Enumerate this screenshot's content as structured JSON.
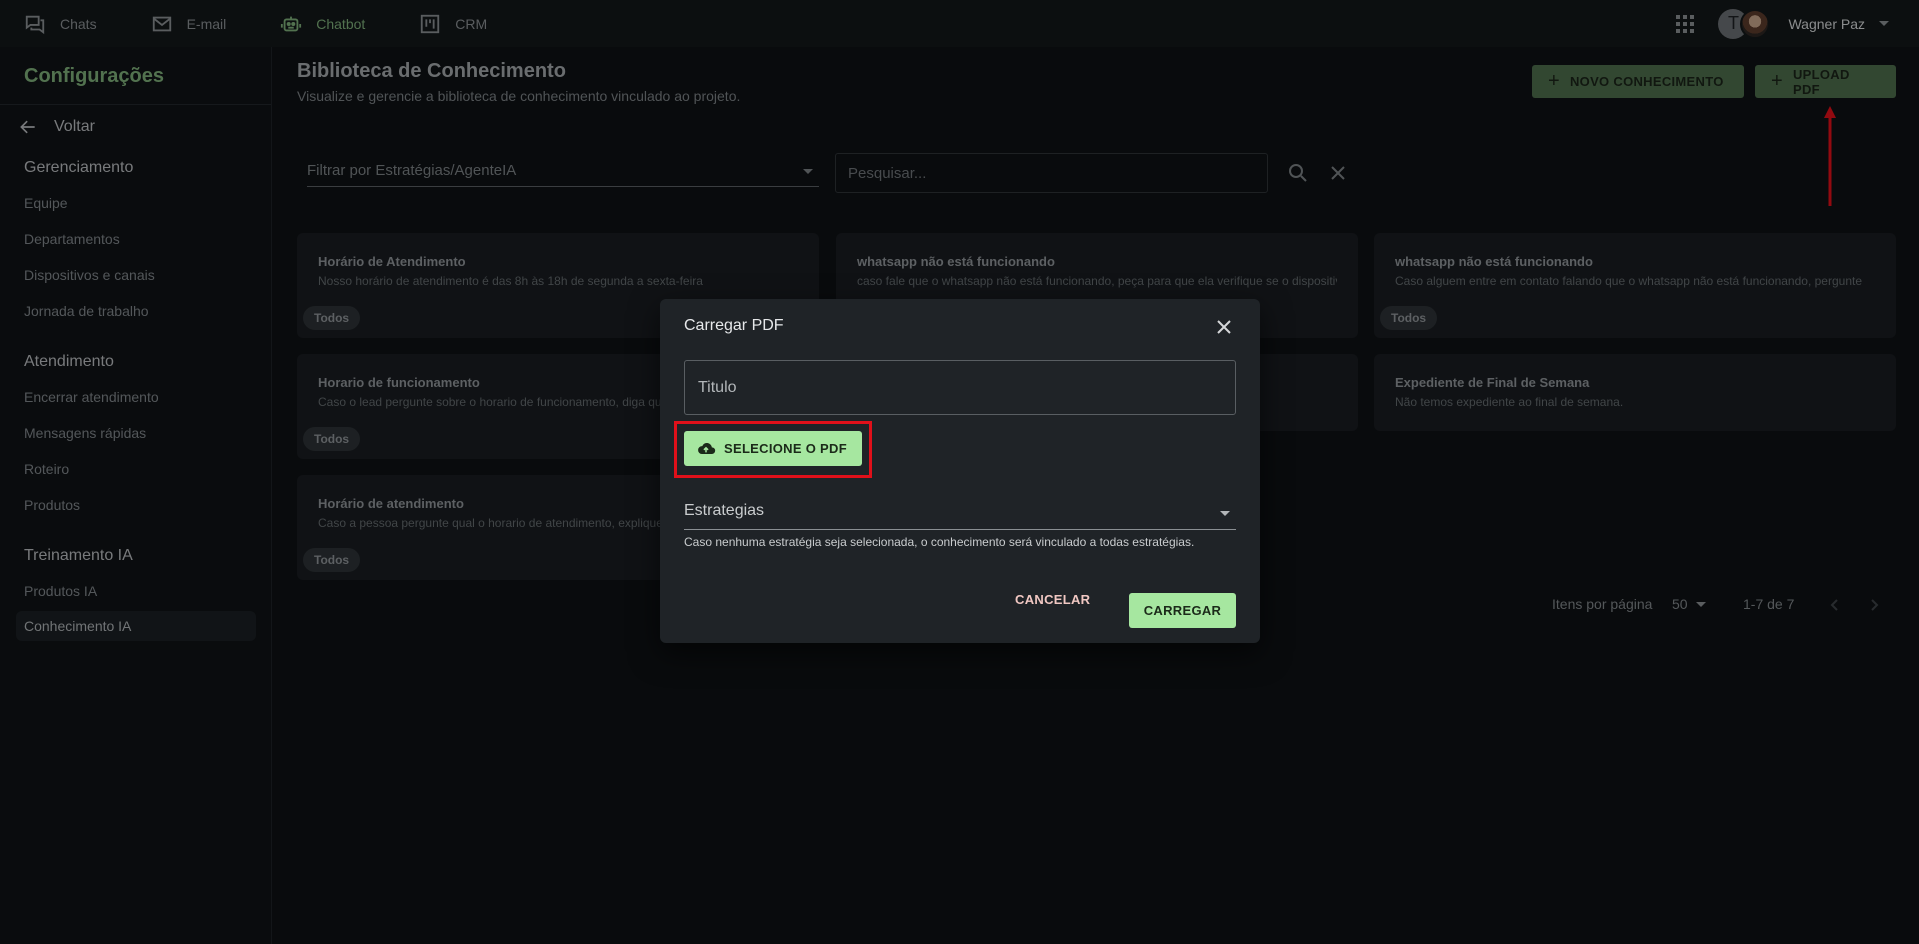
{
  "topbar": {
    "nav": [
      {
        "label": "Chats",
        "icon": "chat-icon"
      },
      {
        "label": "E-mail",
        "icon": "mail-icon"
      },
      {
        "label": "Chatbot",
        "icon": "robot-icon"
      },
      {
        "label": "CRM",
        "icon": "kanban-icon"
      }
    ],
    "active_nav": "Chatbot",
    "avatar_initial": "T",
    "user_name": "Wagner Paz"
  },
  "sidebar": {
    "title": "Configurações",
    "back": "Voltar",
    "sections": [
      {
        "title": "Gerenciamento",
        "items": [
          "Equipe",
          "Departamentos",
          "Dispositivos e canais",
          "Jornada de trabalho"
        ]
      },
      {
        "title": "Atendimento",
        "items": [
          "Encerrar atendimento",
          "Mensagens rápidas",
          "Roteiro",
          "Produtos"
        ]
      },
      {
        "title": "Treinamento IA",
        "items": [
          "Produtos IA",
          "Conhecimento IA"
        ]
      }
    ],
    "active_item": "Conhecimento IA"
  },
  "main": {
    "title": "Biblioteca de Conhecimento",
    "subtitle": "Visualize e gerencie a biblioteca de conhecimento vinculado ao projeto.",
    "new_button": "NOVO CONHECIMENTO",
    "upload_button": "UPLOAD PDF",
    "filter_placeholder": "Filtrar por Estratégias/AgenteIA",
    "search_placeholder": "Pesquisar..."
  },
  "cards": [
    {
      "title": "Horário de Atendimento",
      "text": "Nosso horário de atendimento é das 8h às 18h de segunda a sexta-feira",
      "tag": "Todos"
    },
    {
      "title": "whatsapp não está funcionando",
      "text": "caso fale que o whatsapp não está funcionando, peça para que ela verifique se o dispositivo",
      "tag": ""
    },
    {
      "title": "whatsapp não está funcionando",
      "text": "Caso alguem entre em contato falando que o whatsapp não está funcionando, pergunte",
      "tag": "Todos"
    },
    {
      "title": "Horario de funcionamento",
      "text": "Caso o lead pergunte sobre o horario de funcionamento, diga que",
      "tag": "Todos"
    },
    {
      "title": "",
      "text": "",
      "tag": ""
    },
    {
      "title": "Expediente de Final de Semana",
      "text": "Não temos expediente ao final de semana.",
      "tag": ""
    },
    {
      "title": "Horário de atendimento",
      "text": "Caso a pessoa pergunte qual o horario de atendimento, explique",
      "tag": "Todos"
    }
  ],
  "pagination": {
    "label": "Itens por página",
    "per_page": "50",
    "range": "1-7 de 7"
  },
  "modal": {
    "title": "Carregar PDF",
    "title_placeholder": "Titulo",
    "select_pdf": "SELECIONE O PDF",
    "strategies_label": "Estrategias",
    "helper": "Caso nenhuma estratégia seja selecionada, o conhecimento será vinculado a todas estratégias.",
    "cancel": "CANCELAR",
    "submit": "CARREGAR"
  },
  "colors": {
    "accent": "#7fb07a",
    "button_green": "#a6e7a0",
    "highlight": "#e0101a"
  }
}
